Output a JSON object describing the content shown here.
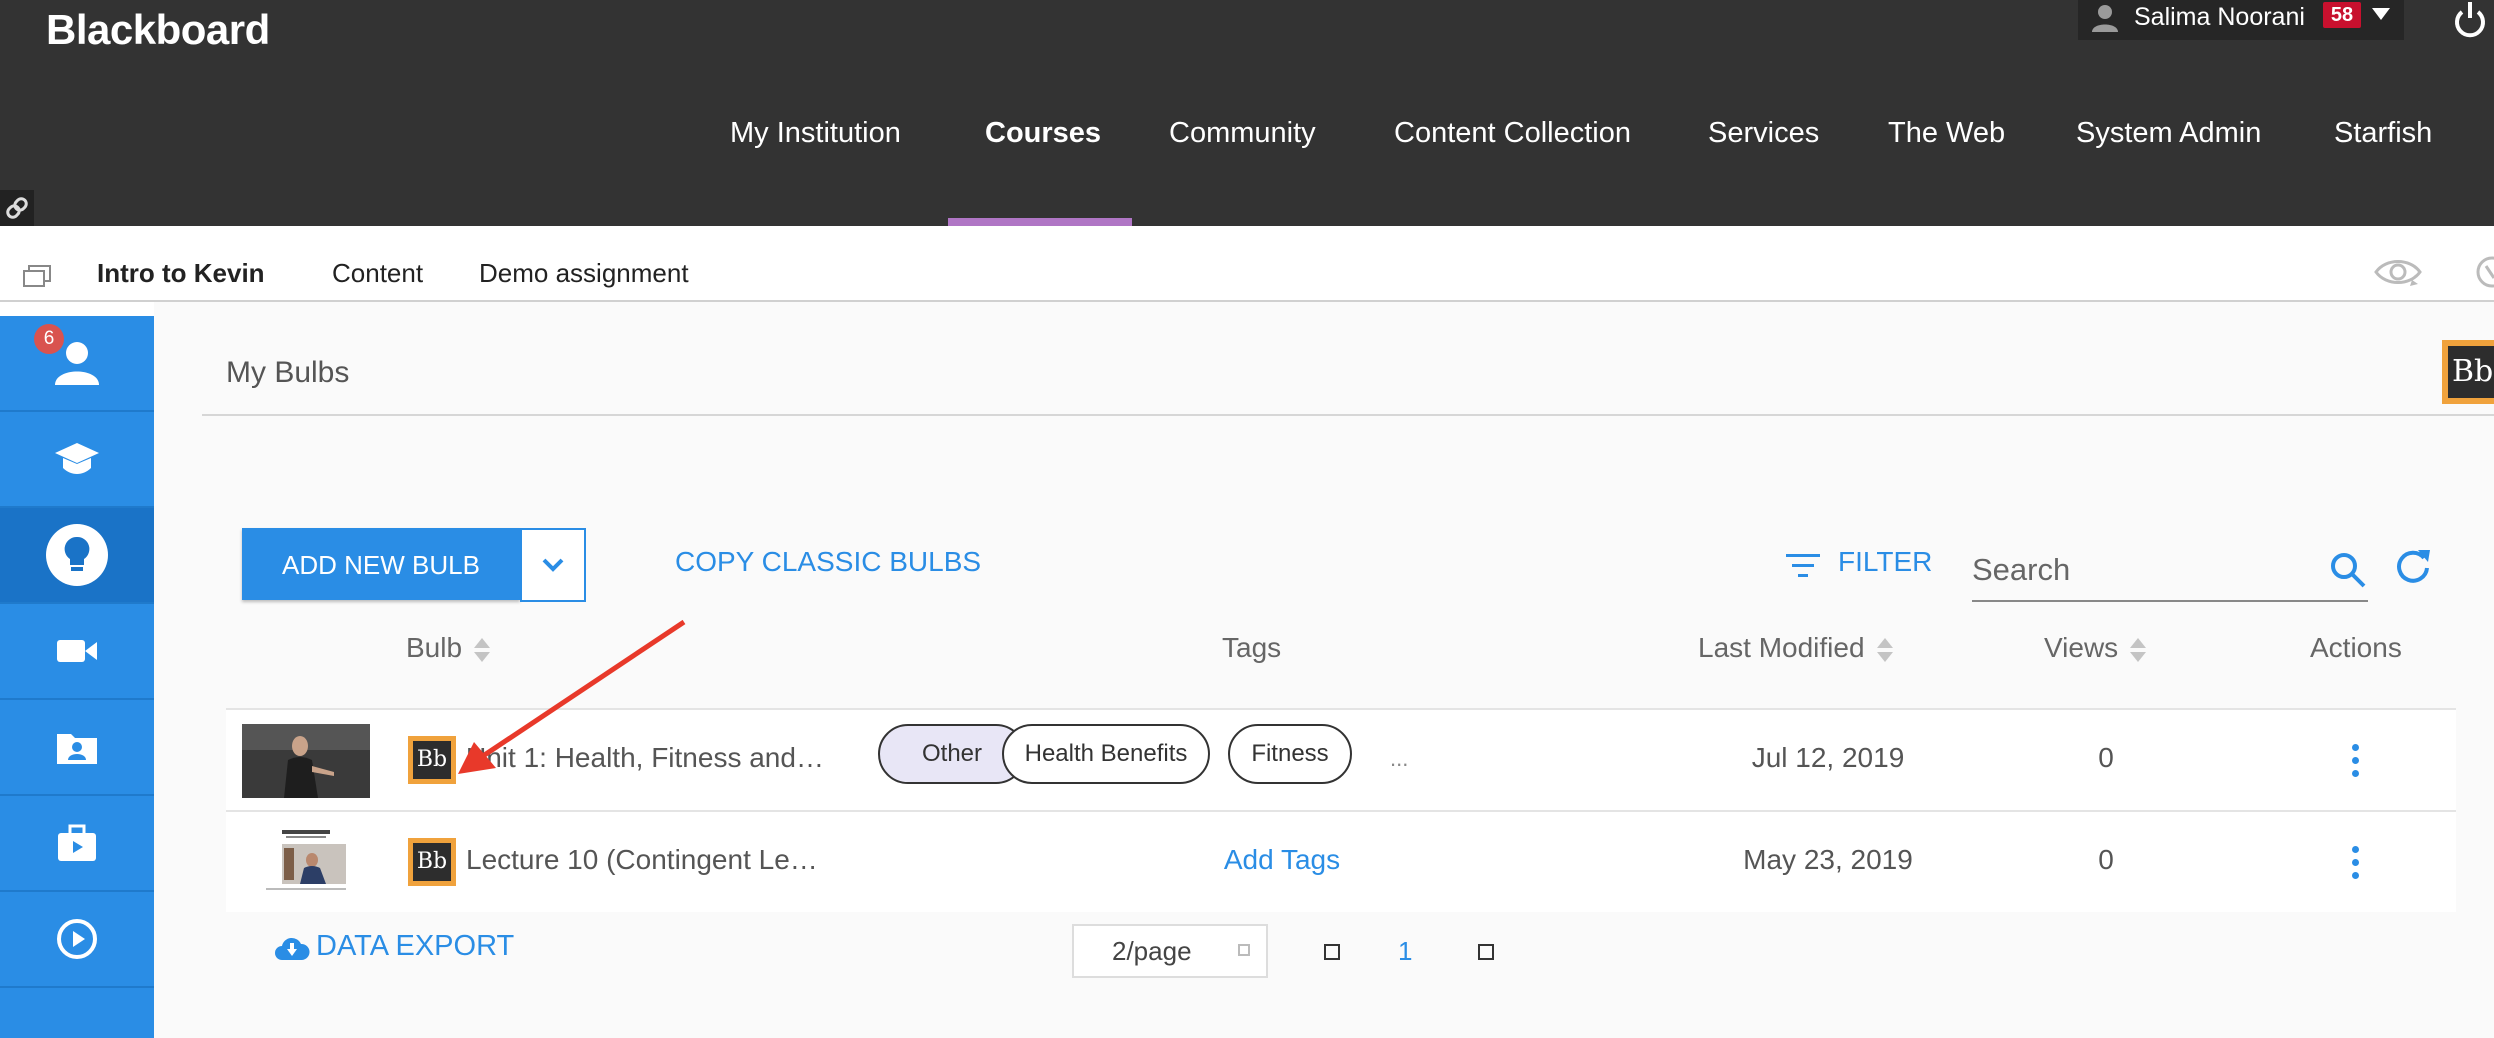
{
  "header": {
    "logo": "Blackboard",
    "user_name": "Salima Noorani",
    "notification_count": "58",
    "nav": [
      {
        "label": "My Institution"
      },
      {
        "label": "Courses",
        "active": true
      },
      {
        "label": "Community"
      },
      {
        "label": "Content Collection"
      },
      {
        "label": "Services"
      },
      {
        "label": "The Web"
      },
      {
        "label": "System Admin"
      },
      {
        "label": "Starfish"
      }
    ]
  },
  "course_bar": {
    "course_title": "Intro to Kevin",
    "crumbs": [
      "Content",
      "Demo assignment"
    ]
  },
  "sidebar": {
    "badge_count": "6",
    "items": [
      {
        "icon": "user-icon"
      },
      {
        "icon": "graduation-cap-icon"
      },
      {
        "icon": "lightbulb-icon",
        "active": true
      },
      {
        "icon": "video-camera-icon"
      },
      {
        "icon": "folder-user-icon"
      },
      {
        "icon": "briefcase-icon"
      },
      {
        "icon": "play-circle-icon"
      }
    ]
  },
  "main": {
    "title": "My Bulbs",
    "add_button": "ADD NEW BULB",
    "copy_link": "COPY CLASSIC BULBS",
    "filter_label": "FILTER",
    "search_placeholder": "Search",
    "columns": {
      "bulb": "Bulb",
      "tags": "Tags",
      "last_modified": "Last Modified",
      "views": "Views",
      "actions": "Actions"
    },
    "rows": [
      {
        "name": "Unit 1: Health, Fitness and…",
        "tags": [
          "Other",
          "Health Benefits",
          "Fitness"
        ],
        "more_tags": "...",
        "last_modified": "Jul 12, 2019",
        "views": "0"
      },
      {
        "name": "Lecture 10 (Contingent Le…",
        "add_tags": "Add Tags",
        "last_modified": "May 23, 2019",
        "views": "0"
      }
    ],
    "data_export": "DATA EXPORT",
    "page_size": "2/page",
    "current_page": "1"
  },
  "icon_text": {
    "bb": "Bb"
  },
  "colors": {
    "accent": "#2a8de5",
    "topbar": "#333333",
    "active_tab_underline": "#b076c5",
    "annotation_arrow": "#e8392a"
  }
}
